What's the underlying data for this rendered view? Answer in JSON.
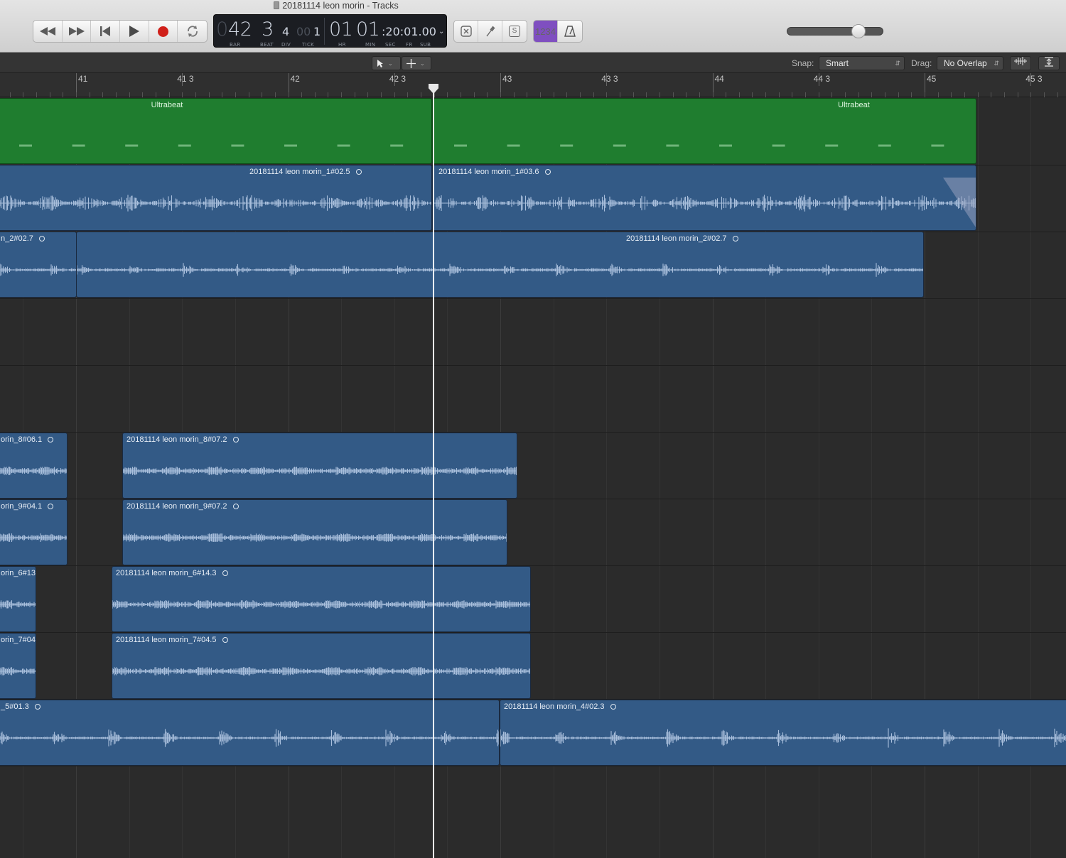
{
  "window": {
    "title": "20181114 leon morin - Tracks"
  },
  "transport": {
    "rewind_icon": "rewind-icon",
    "forward_icon": "fast-forward-icon",
    "tostart_icon": "go-to-start-icon",
    "play_icon": "play-icon",
    "record_icon": "record-icon",
    "cycle_icon": "cycle-icon"
  },
  "lcd": {
    "bar_dim": "0",
    "bar": "42",
    "beat": "3",
    "div": "4",
    "tick_dim": "00",
    "tick": "1",
    "hr": "01",
    "min": "01",
    "sec_fr_sub": ":20:01.00",
    "labels": {
      "bar": "BAR",
      "beat": "BEAT",
      "div": "DIV",
      "tick": "TICK",
      "hr": "HR",
      "min": "MIN",
      "sec": "SEC",
      "fr": "FR",
      "sub": "SUB"
    }
  },
  "tools": {
    "countin_label": "1234",
    "solo_label": "S"
  },
  "master_volume": {
    "level": 0.74
  },
  "trackbar": {
    "snap_label": "Snap:",
    "snap_value": "Smart",
    "drag_label": "Drag:",
    "drag_value": "No Overlap"
  },
  "ruler": {
    "labels": [
      "41",
      "41 3",
      "42",
      "42 3",
      "43",
      "43 3",
      "44",
      "44 3",
      "45",
      "45 3"
    ]
  },
  "playhead": {
    "position": "42 3 4 1"
  },
  "regions": [
    {
      "name": "Ultrabeat",
      "type": "midi"
    },
    {
      "name": "Ultrabeat",
      "type": "midi"
    },
    {
      "name": "20181114 leon morin_1#02.5",
      "type": "audio"
    },
    {
      "name": "20181114 leon morin_1#03.6",
      "type": "audio"
    },
    {
      "name": "n_2#02.7",
      "type": "audio"
    },
    {
      "name": "20181114 leon morin_2#02.7",
      "type": "audio"
    },
    {
      "name": "orin_8#06.1",
      "type": "audio"
    },
    {
      "name": "20181114 leon morin_8#07.2",
      "type": "audio"
    },
    {
      "name": "orin_9#04.1",
      "type": "audio"
    },
    {
      "name": "20181114 leon morin_9#07.2",
      "type": "audio"
    },
    {
      "name": "orin_6#13.",
      "type": "audio"
    },
    {
      "name": "20181114 leon morin_6#14.3",
      "type": "audio"
    },
    {
      "name": "orin_7#04.",
      "type": "audio"
    },
    {
      "name": "20181114 leon morin_7#04.5",
      "type": "audio"
    },
    {
      "name": "_5#01.3",
      "type": "audio"
    },
    {
      "name": "20181114 leon morin_4#02.3",
      "type": "audio"
    }
  ]
}
